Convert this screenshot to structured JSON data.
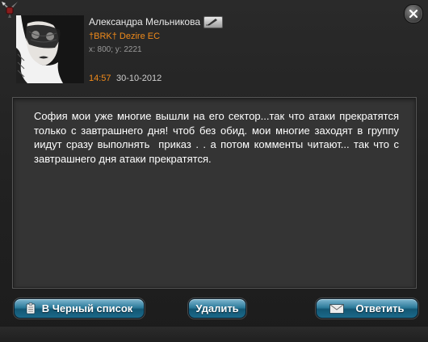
{
  "author": {
    "name": "Александра Мельникова",
    "clan": "†BRK† Dezire EC",
    "coords": "x: 800; y: 2221"
  },
  "timestamp": {
    "time": "14:57",
    "date": "30-10-2012"
  },
  "message": {
    "text": "София мои уже многие вышли на его сектор...так что атаки прекратятся только с завтрашнего дня! чтоб без обид. мои многие заходят в группу  иидут сразу выполнять  приказ . . а потом комменты читают... так что с завтрашнего дня атаки прекратятся."
  },
  "buttons": {
    "blacklist": "В Черный список",
    "delete": "Удалить",
    "reply": "Ответить"
  },
  "icons": {
    "emblem": "sword-emblem-icon",
    "close": "close-icon",
    "edit": "pencil-icon",
    "blacklist": "clipboard-icon",
    "reply": "envelope-icon"
  },
  "colors": {
    "accent": "#f08a1a",
    "button": "#2d7c9c"
  }
}
